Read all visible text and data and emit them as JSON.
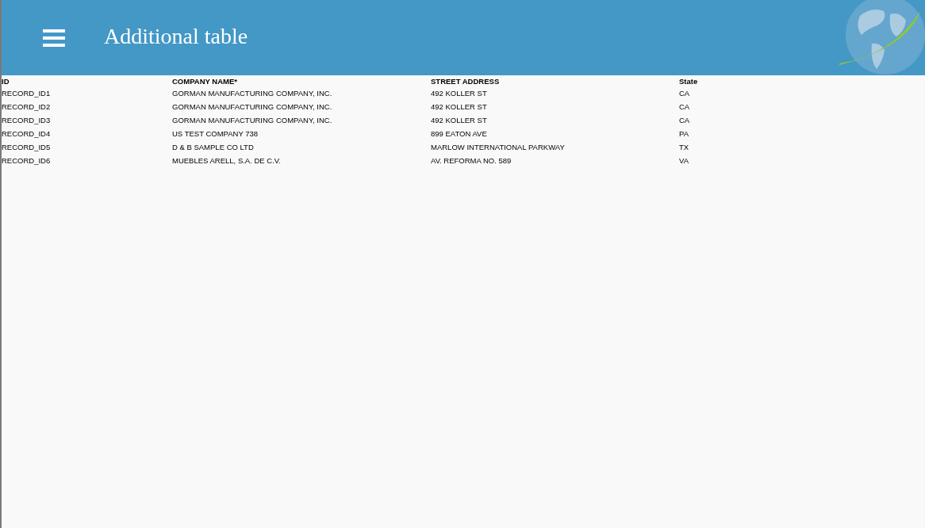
{
  "header": {
    "title": "Additional table"
  },
  "table": {
    "columns": [
      "ID",
      "COMPANY NAME*",
      "STREET ADDRESS",
      "State"
    ],
    "rows": [
      [
        "RECORD_ID1",
        "GORMAN MANUFACTURING COMPANY, INC.",
        "492 KOLLER ST",
        "CA"
      ],
      [
        "RECORD_ID2",
        "GORMAN MANUFACTURING COMPANY, INC.",
        "492 KOLLER ST",
        "CA"
      ],
      [
        "RECORD_ID3",
        "GORMAN MANUFACTURING COMPANY, INC.",
        "492 KOLLER ST",
        "CA"
      ],
      [
        "RECORD_ID4",
        "US TEST COMPANY 738",
        "899 EATON AVE",
        "PA"
      ],
      [
        "RECORD_ID5",
        "D & B SAMPLE CO LTD",
        "MARLOW INTERNATIONAL PARKWAY",
        "TX"
      ],
      [
        "RECORD_ID6",
        "MUEBLES ARELL, S.A. DE C.V.",
        "AV. REFORMA NO. 589",
        "VA"
      ]
    ]
  }
}
